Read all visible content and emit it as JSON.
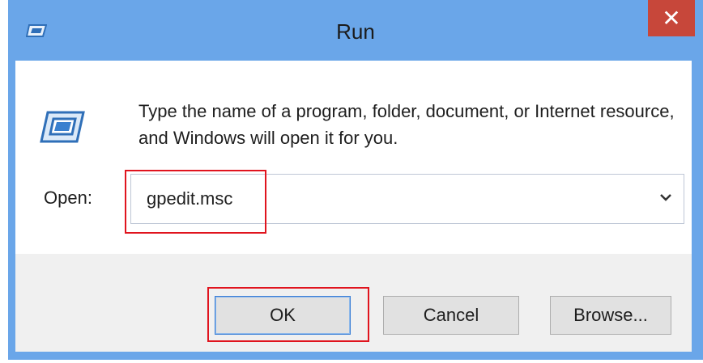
{
  "window": {
    "title": "Run",
    "close_glyph": "✕",
    "icons": [
      "run-icon",
      "close-icon",
      "chevron-down-icon"
    ],
    "colors": {
      "frame": "#6aa6e9",
      "close": "#c7473a",
      "highlight": "#e0141e",
      "footer": "#f0f0f0"
    }
  },
  "dialog": {
    "description": "Type the name of a program, folder, document, or Internet resource, and Windows will open it for you.",
    "open_label": "Open:",
    "open_value": "gpedit.msc"
  },
  "buttons": {
    "ok": "OK",
    "cancel": "Cancel",
    "browse": "Browse..."
  }
}
